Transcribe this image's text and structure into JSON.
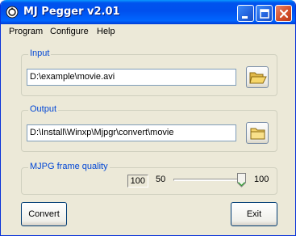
{
  "window": {
    "title": "MJ Pegger v2.01"
  },
  "menu": {
    "items": [
      "Program",
      "Configure",
      "Help"
    ]
  },
  "input": {
    "label": "Input",
    "path": "D:\\example\\movie.avi"
  },
  "output": {
    "label": "Output",
    "path": "D:\\Install\\Winxp\\Mjpgr\\convert\\movie"
  },
  "quality": {
    "label": "MJPG frame quality",
    "value": "100",
    "min": "50",
    "max": "100",
    "slider_fraction": 1.0
  },
  "buttons": {
    "convert": "Convert",
    "exit": "Exit"
  },
  "icons": {
    "app": "app-icon",
    "browse": "open-folder-icon"
  },
  "colors": {
    "titlebar": "#0053ee",
    "group_label": "#0046d5",
    "face": "#ece9d8"
  }
}
